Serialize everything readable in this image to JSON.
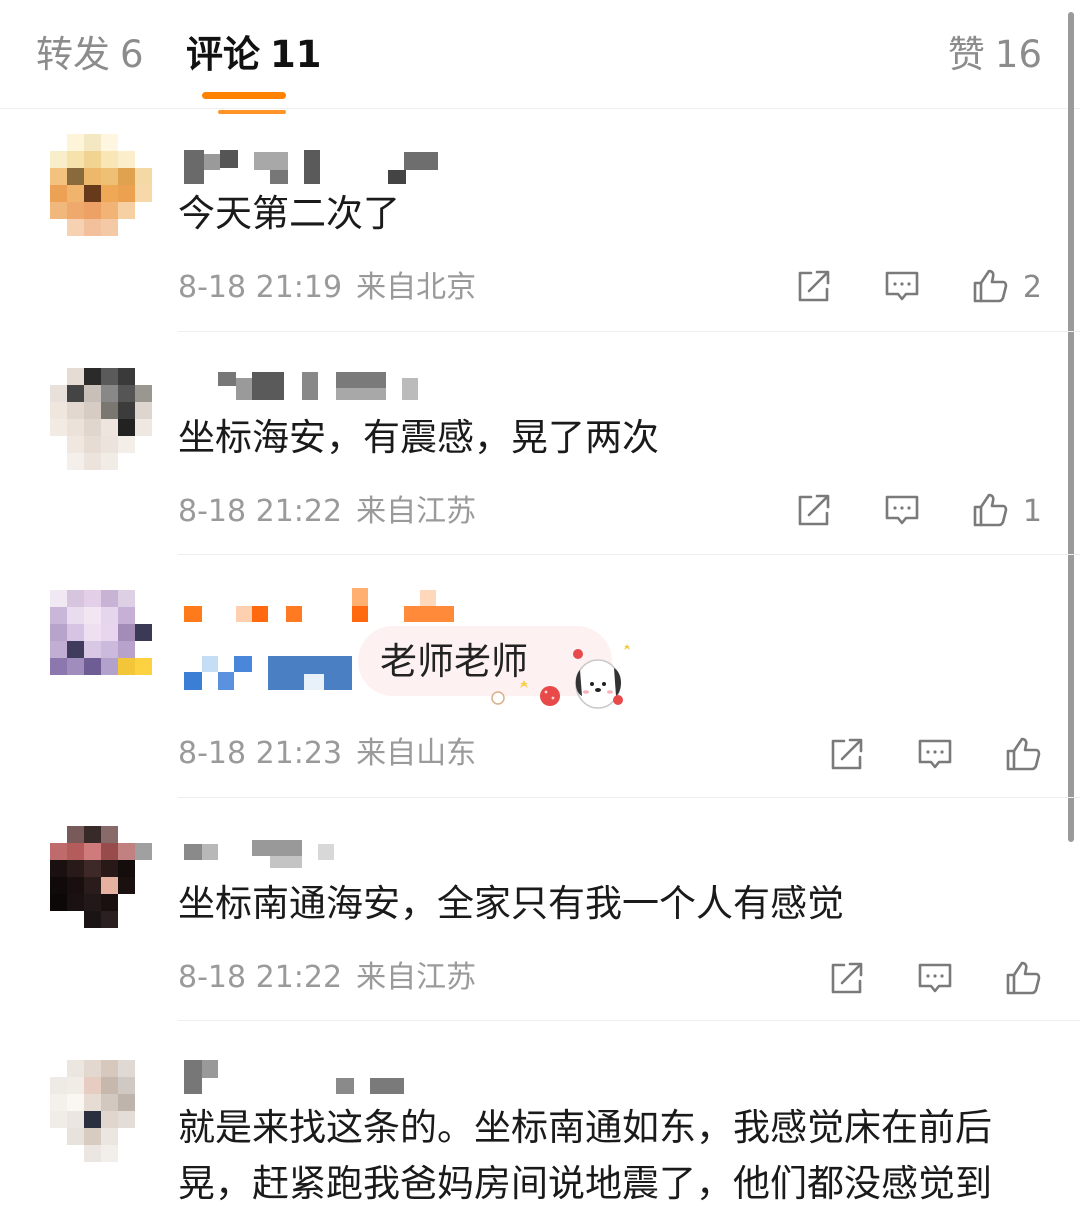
{
  "tabs": {
    "repost": {
      "label": "转发",
      "count": "6"
    },
    "comments": {
      "label": "评论",
      "count": "11"
    },
    "likes": {
      "label": "赞",
      "count": "16"
    }
  },
  "comments": [
    {
      "text": "今天第二次了",
      "time": "8-18 21:19",
      "location": "来自北京",
      "likes": "2"
    },
    {
      "text": "坐标海安，有震感，晃了两次",
      "time": "8-18 21:22",
      "location": "来自江苏",
      "likes": "1"
    },
    {
      "text": "老师老师",
      "time": "8-18 21:23",
      "location": "来自山东",
      "likes": ""
    },
    {
      "text": "坐标南通海安，全家只有我一个人有感觉",
      "time": "8-18 21:22",
      "location": "来自江苏",
      "likes": ""
    },
    {
      "text_line1": "就是来找这条的。坐标南通如东，我感觉床在前后",
      "text_line2": "晃，赶紧跑我爸妈房间说地震了，他们都没感觉到"
    }
  ],
  "icons": {
    "repost": "share-icon",
    "reply": "comment-icon",
    "like": "thumbs-up-icon"
  },
  "colors": {
    "accent": "#ff8200",
    "meta": "#9a9a9a",
    "tab_inactive": "#8c8c8c"
  }
}
